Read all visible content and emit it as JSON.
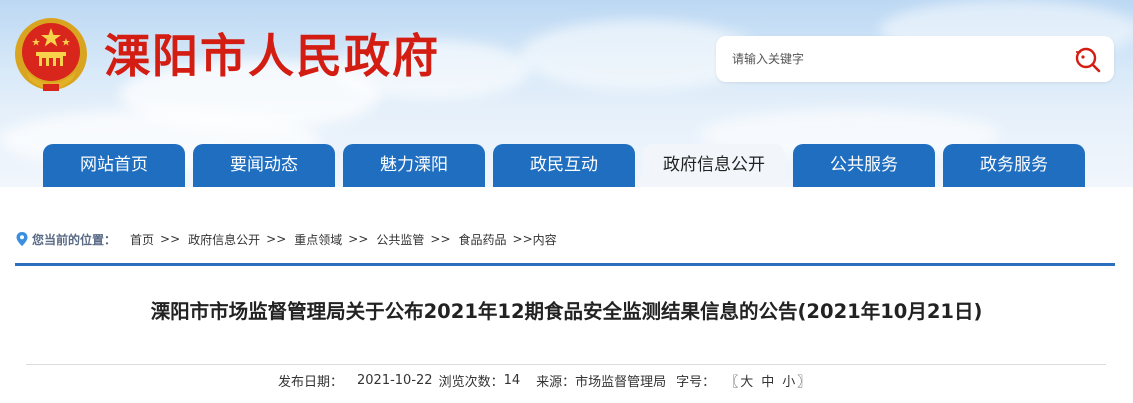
{
  "header": {
    "site_title": "溧阳市人民政府",
    "search": {
      "placeholder": "请输入关键字"
    },
    "colors": {
      "title_red": "#d41d12",
      "nav_blue": "#1f6ec0",
      "line_blue": "#2b6fbe"
    }
  },
  "nav": {
    "tabs": [
      {
        "label": "网站首页",
        "active": false
      },
      {
        "label": "要闻动态",
        "active": false
      },
      {
        "label": "魅力溧阳",
        "active": false
      },
      {
        "label": "政民互动",
        "active": false
      },
      {
        "label": "政府信息公开",
        "active": true
      },
      {
        "label": "公共服务",
        "active": false
      },
      {
        "label": "政务服务",
        "active": false
      }
    ]
  },
  "breadcrumb": {
    "label": "您当前的位置：",
    "items": [
      "首页",
      "政府信息公开",
      "重点领域",
      "公共监管",
      "食品药品"
    ],
    "separator": ">>",
    "current": "内容"
  },
  "article": {
    "title": "溧阳市市场监督管理局关于公布2021年12期食品安全监测结果信息的公告(2021年10月21日)",
    "meta": {
      "date_label": "发布日期：",
      "date": "2021-10-22",
      "views_label": "浏览次数：",
      "views": "14",
      "source_label": "来源：",
      "source": "市场监督管理局",
      "font_label": "字号：",
      "font_open": "〖",
      "font_large": "大",
      "font_medium": "中",
      "font_small": "小",
      "font_close": "〗"
    }
  }
}
